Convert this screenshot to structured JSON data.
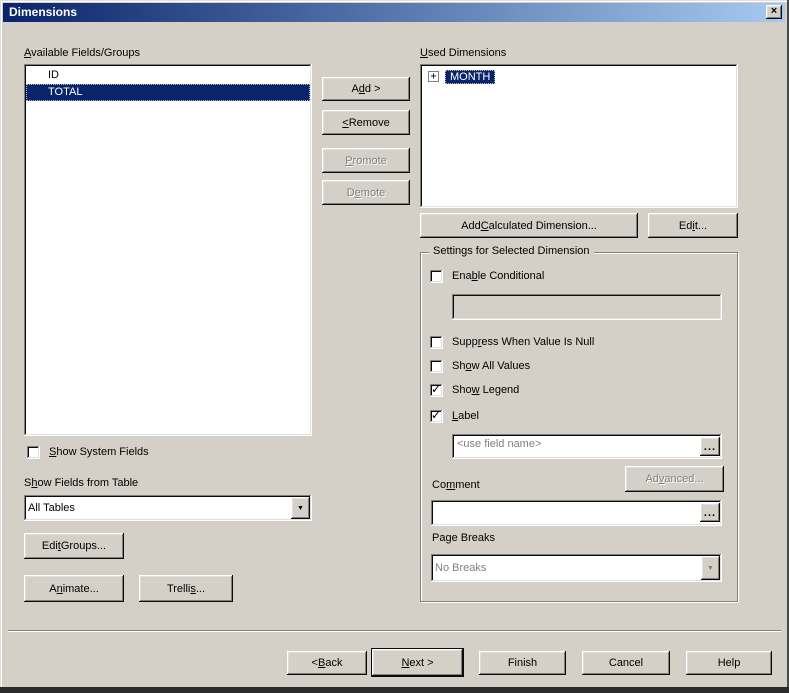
{
  "window": {
    "title": "Dimensions"
  },
  "icons": {
    "close": "×",
    "dropdown": "▼",
    "check": "✓",
    "tree_expand": "+",
    "ellipsis": "..."
  },
  "colors": {
    "face": "#D4D0C8",
    "highlight": "#0A246A",
    "title_gradient_from": "#0A246A",
    "title_gradient_to": "#A6CAF0"
  },
  "left": {
    "available_label": "Available Fields/Groups",
    "fields": [
      {
        "label": "ID",
        "selected": false
      },
      {
        "label": "TOTAL",
        "selected": true
      }
    ],
    "show_system_fields": {
      "label": "Show System Fields",
      "checked": false
    },
    "show_fields_from_table_label": "Show Fields from Table",
    "table_filter_value": "All Tables",
    "edit_groups_label": "Edit Groups...",
    "animate_label": "Animate...",
    "trellis_label": "Trellis..."
  },
  "middle": {
    "add_label": "Add >",
    "remove_label": "< Remove",
    "promote_label": "Promote",
    "demote_label": "Demote"
  },
  "right": {
    "used_label": "Used Dimensions",
    "tree": [
      {
        "label": "MONTH",
        "expanded": false,
        "selected": true
      }
    ],
    "add_calc_label": "Add Calculated Dimension...",
    "edit_label": "Edit...",
    "settings": {
      "legend": "Settings for Selected Dimension",
      "enable_conditional": {
        "label": "Enable Conditional",
        "checked": false
      },
      "conditional_value": "",
      "suppress_null": {
        "label": "Suppress When Value Is Null",
        "checked": false
      },
      "show_all_values": {
        "label": "Show All Values",
        "checked": false
      },
      "show_legend": {
        "label": "Show Legend",
        "checked": true
      },
      "label_cb": {
        "label": "Label",
        "checked": true
      },
      "label_field": {
        "value": "",
        "placeholder": "<use field name>"
      },
      "advanced_label": "Advanced...",
      "comment_label": "Comment",
      "comment_value": "",
      "page_breaks_label": "Page Breaks",
      "page_breaks_value": "No Breaks"
    }
  },
  "footer": {
    "back_label": "< Back",
    "next_label": "Next >",
    "finish_label": "Finish",
    "cancel_label": "Cancel",
    "help_label": "Help"
  }
}
